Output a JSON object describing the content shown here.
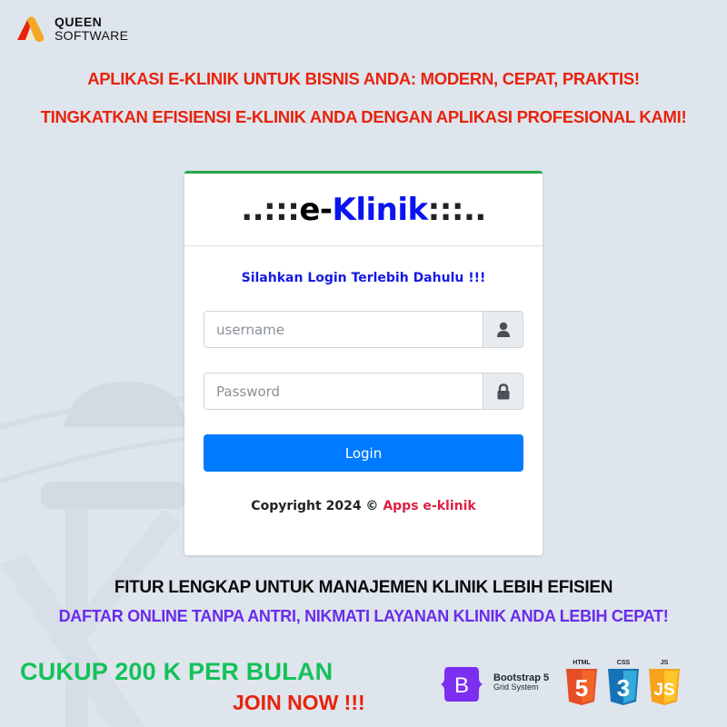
{
  "brand": {
    "name_line1": "QUEEN",
    "name_line2": "SOFTWARE",
    "logo_icon": "a-shape-logo-icon"
  },
  "headlines": {
    "line1": "APLIKASI E-KLINIK UNTUK BISNIS ANDA: MODERN, CEPAT, PRAKTIS!",
    "line2": "TINGKATKAN EFISIENSI E-KLINIK ANDA DENGAN APLIKASI PROFESIONAL KAMI!"
  },
  "login_card": {
    "title_prefix_dots": "..:::",
    "title_e": "e-",
    "title_klinik": "Klinik",
    "title_suffix_dots": ":::..",
    "message": "Silahkan Login Terlebih Dahulu !!!",
    "username": {
      "value": "",
      "placeholder": "username",
      "icon": "user-icon"
    },
    "password": {
      "value": "",
      "placeholder": "Password",
      "icon": "lock-icon"
    },
    "login_button": "Login",
    "copyright_prefix": "Copyright 2024 ©",
    "copyright_app": "Apps e-klinik",
    "accent_color": "#28a745",
    "button_color": "#007bff"
  },
  "features": {
    "title": "FITUR LENGKAP UNTUK MANAJEMEN KLINIK LEBIH EFISIEN",
    "subtitle": "DAFTAR ONLINE TANPA ANTRI, NIKMATI LAYANAN KLINIK ANDA LEBIH CEPAT!"
  },
  "pricing": {
    "price_text": "CUKUP 200 K PER BULAN",
    "cta_text": "JOIN NOW !!!"
  },
  "tech_stack": {
    "bootstrap_name": "Bootstrap 5",
    "bootstrap_sub": "Grid System",
    "bootstrap_glyph": "B",
    "html_label": "HTML",
    "html_glyph": "5",
    "css_label": "CSS",
    "css_glyph": "3",
    "js_label": "JS",
    "js_glyph": "JS"
  }
}
